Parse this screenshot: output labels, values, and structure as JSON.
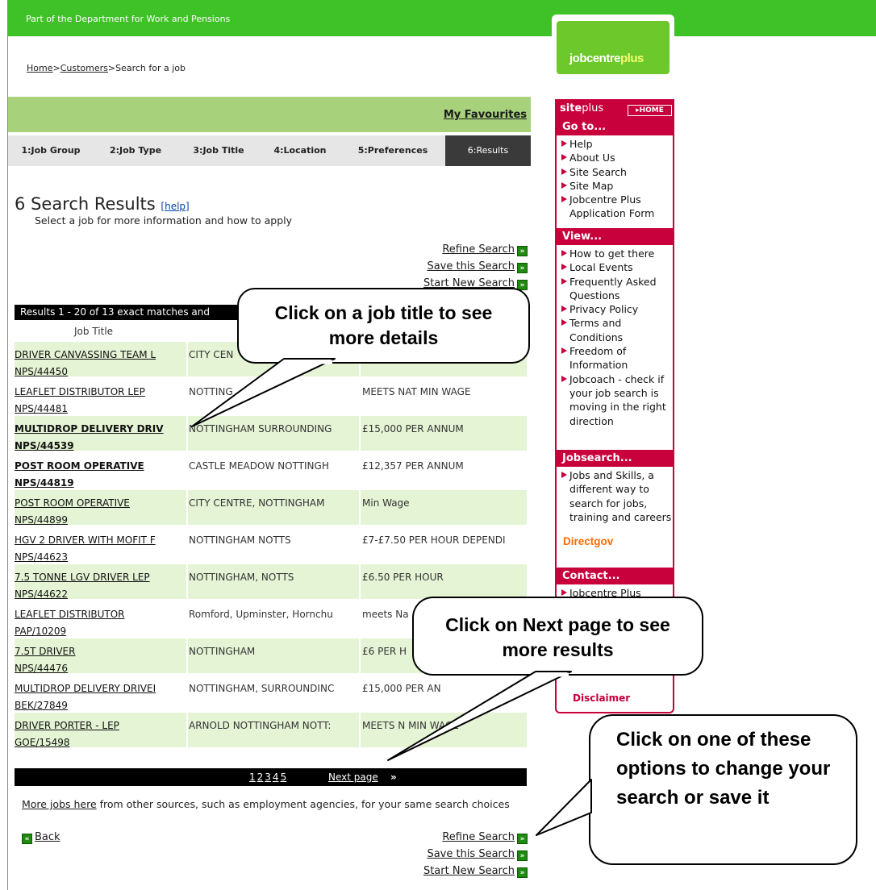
{
  "header": {
    "department": "Part of the Department for Work and Pensions",
    "breadcrumb": [
      {
        "label": "Home",
        "link": true
      },
      {
        "label": ">",
        "link": false
      },
      {
        "label": "Customers",
        "link": true
      },
      {
        "label": ">Search for a job",
        "link": false
      }
    ],
    "logo": {
      "text_a": "jobcentre",
      "text_b": "plus"
    }
  },
  "favourites_label": "My Favourites",
  "steps": [
    {
      "label": "1:Job Group"
    },
    {
      "label": "2:Job Type"
    },
    {
      "label": "3:Job Title"
    },
    {
      "label": "4:Location"
    },
    {
      "label": "5:Preferences"
    },
    {
      "label": "6:Results",
      "current": true
    }
  ],
  "results": {
    "count": "6",
    "title": "Search Results",
    "help_label": "[help]",
    "subtitle": "Select a job for more information and how to apply",
    "refine_label": "Refine Search",
    "save_label": "Save this Search",
    "new_label": "Start New Search",
    "summary": "Results 1 - 20 of 13 exact matches and",
    "column_job_title": "Job Title",
    "rows": [
      {
        "title": "DRIVER CANVASSING TEAM L",
        "ref": "NPS/44450",
        "location": "CITY CEN",
        "pay": "",
        "bold": false
      },
      {
        "title": "LEAFLET DISTRIBUTOR LEP",
        "ref": "NPS/44481",
        "location": "NOTTING",
        "pay": "MEETS NAT MIN WAGE",
        "bold": false
      },
      {
        "title": "MULTIDROP DELIVERY DRIV",
        "ref": "NPS/44539",
        "location": "NOTTINGHAM SURROUNDING",
        "pay": "£15,000 PER ANNUM",
        "bold": true
      },
      {
        "title": "POST ROOM OPERATIVE",
        "ref": "NPS/44819",
        "location": "CASTLE MEADOW NOTTINGH",
        "pay": "£12,357 PER ANNUM",
        "bold": true
      },
      {
        "title": "POST ROOM OPERATIVE",
        "ref": "NPS/44899",
        "location": "CITY CENTRE, NOTTINGHAM",
        "pay": "Min Wage",
        "bold": false
      },
      {
        "title": "HGV 2 DRIVER WITH MOFIT F",
        "ref": "NPS/44623",
        "location": "NOTTINGHAM NOTTS",
        "pay": "£7-£7.50 PER HOUR DEPENDI",
        "bold": false
      },
      {
        "title": "7.5 TONNE LGV DRIVER LEP",
        "ref": "NPS/44622",
        "location": "NOTTINGHAM, NOTTS",
        "pay": "£6.50 PER HOUR",
        "bold": false
      },
      {
        "title": "LEAFLET DISTRIBUTOR",
        "ref": "PAP/10209",
        "location": "Romford, Upminster, Hornchu",
        "pay": "meets Na",
        "bold": false
      },
      {
        "title": "7.5T DRIVER",
        "ref": "NPS/44476",
        "location": "NOTTINGHAM",
        "pay": "£6 PER H",
        "bold": false
      },
      {
        "title": "MULTIDROP DELIVERY DRIVEI",
        "ref": "BEK/27849",
        "location": "NOTTINGHAM, SURROUNDINC",
        "pay": "£15,000 PER AN",
        "bold": false
      },
      {
        "title": "DRIVER PORTER - LEP",
        "ref": "GOE/15498",
        "location": "ARNOLD NOTTINGHAM NOTT:",
        "pay": "MEETS N      MIN WAGE",
        "bold": false
      }
    ],
    "pages": [
      "1",
      "2",
      "3",
      "4",
      "5"
    ],
    "next_label": "Next page",
    "next_chevron": "»",
    "more_link": "More jobs here",
    "more_text": " from other sources, such as employment agencies, for your same search choices",
    "back_label": "Back"
  },
  "siteplus": {
    "brand_a": "site",
    "brand_b": "plus",
    "home_label": "▸HOME",
    "goto": {
      "heading": "Go to...",
      "items": [
        "Help",
        "About Us",
        "Site Search",
        "Site Map",
        "Jobcentre Plus Application Form"
      ]
    },
    "view": {
      "heading": "View...",
      "items": [
        "How to get there",
        "Local Events",
        "Frequently Asked Questions",
        "Privacy Policy",
        "Terms and Conditions",
        "Freedom of Information",
        "Jobcoach - check if your job search is moving in the right direction"
      ]
    },
    "jobsearch": {
      "heading": "Jobsearch...",
      "items": [
        "Jobs and Skills, a different way to search for jobs, training and careers"
      ],
      "directgov": "Directgov"
    },
    "contact": {
      "heading": "Contact...",
      "items": [
        "Jobcentre Plus"
      ]
    },
    "disclaimer": "Disclaimer"
  },
  "callouts": {
    "job_title": "Click on a job title to see more details",
    "next_page": "Click on Next page to see more results",
    "options": "Click on one of these options to change your search or save it"
  }
}
